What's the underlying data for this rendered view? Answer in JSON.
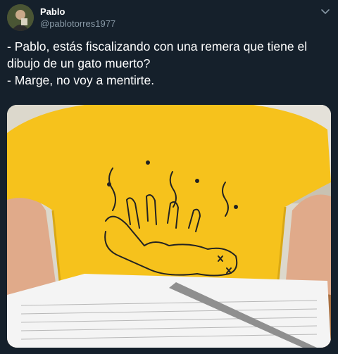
{
  "tweet": {
    "author_name": "Pablo",
    "author_handle": "@pablotorres1977",
    "text_lines": [
      "- Pablo, estás fiscalizando con una remera que tiene el",
      "dibujo de un gato muerto?",
      "- Marge, no voy a mentirte."
    ],
    "icons": {
      "menu": "chevron-down-icon",
      "avatar": "avatar"
    },
    "media": {
      "description_icon": "photo",
      "shirt_color": "#f6c21c",
      "background_color": "#15202b"
    }
  }
}
